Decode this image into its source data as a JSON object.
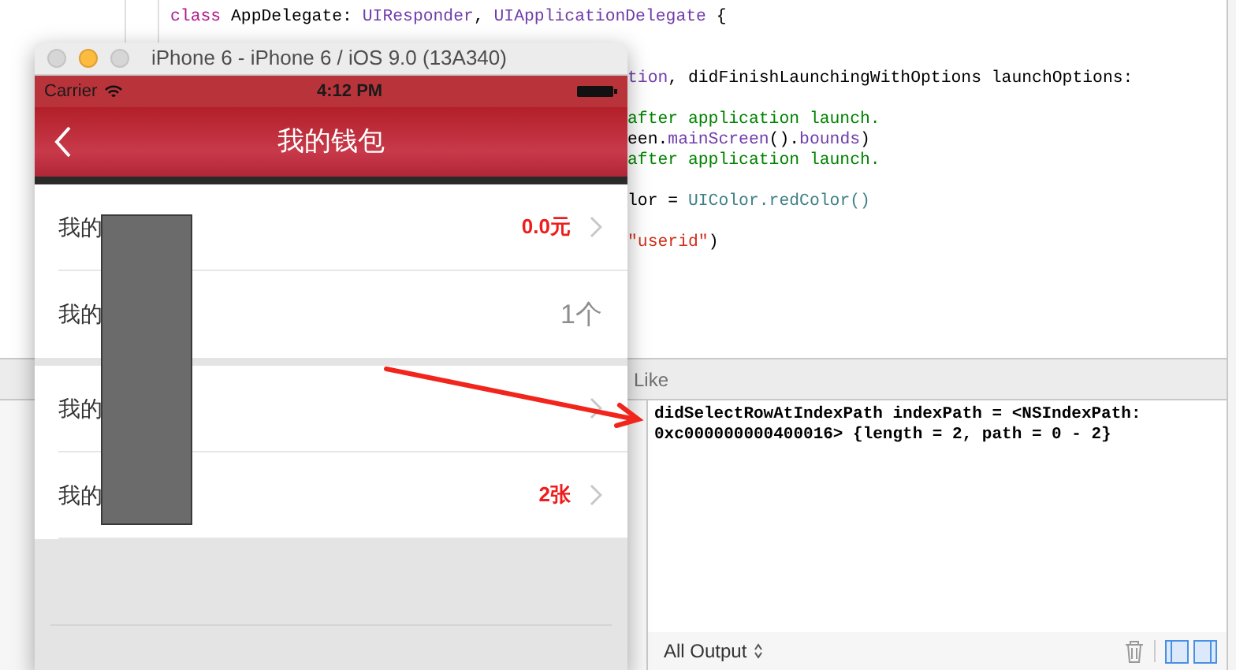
{
  "editor": {
    "code_lines": [
      {
        "kind": "full",
        "segments": [
          {
            "kind": "keyword",
            "text": "class"
          },
          {
            "kind": "plain",
            "text": " AppDelegate: "
          },
          {
            "kind": "type",
            "text": "UIResponder"
          },
          {
            "kind": "plain",
            "text": ", "
          },
          {
            "kind": "type",
            "text": "UIApplicationDelegate"
          },
          {
            "kind": "plain",
            "text": " {"
          }
        ]
      },
      {
        "kind": "blank"
      },
      {
        "kind": "blank"
      },
      {
        "kind": "clipped",
        "segments": [
          {
            "kind": "type",
            "text": "tion"
          },
          {
            "kind": "plain",
            "text": ", didFinishLaunchingWithOptions launchOptions:"
          }
        ]
      },
      {
        "kind": "blank"
      },
      {
        "kind": "clipped",
        "segments": [
          {
            "kind": "comment",
            "text": "after application launch."
          }
        ]
      },
      {
        "kind": "clipped",
        "segments": [
          {
            "kind": "plain",
            "text": "een."
          },
          {
            "kind": "type",
            "text": "mainScreen"
          },
          {
            "kind": "plain",
            "text": "()."
          },
          {
            "kind": "type",
            "text": "bounds"
          },
          {
            "kind": "plain",
            "text": ")"
          }
        ]
      },
      {
        "kind": "clipped",
        "segments": [
          {
            "kind": "comment",
            "text": "after application launch."
          }
        ]
      },
      {
        "kind": "blank"
      },
      {
        "kind": "clipped",
        "segments": [
          {
            "kind": "plain",
            "text": "lor = "
          },
          {
            "kind": "call",
            "text": "UIColor.redColor()"
          }
        ]
      },
      {
        "kind": "blank"
      },
      {
        "kind": "clipped",
        "segments": [
          {
            "kind": "string",
            "text": "\"userid\""
          },
          {
            "kind": "plain",
            "text": ")"
          }
        ]
      }
    ]
  },
  "debug": {
    "tab_label": "Like",
    "output": [
      "didSelectRowAtIndexPath indexPath = <NSIndexPath:",
      "0xc000000000400016> {length = 2, path = 0 - 2}"
    ],
    "filter": "All Output"
  },
  "simulator": {
    "title": "iPhone 6 - iPhone 6 / iOS 9.0 (13A340)",
    "carrier": "Carrier",
    "time": "4:12 PM",
    "nav_title": "我的钱包",
    "sections": [
      [
        {
          "label": "我的",
          "value": "0.0元",
          "kind": "accent",
          "chevron": true
        },
        {
          "label": "我的",
          "value": "1个",
          "kind": "muted",
          "chevron": false
        }
      ],
      [
        {
          "label": "我的",
          "chevron": true
        },
        {
          "label": "我的",
          "value": "2张",
          "kind": "accent",
          "chevron": true
        }
      ]
    ]
  }
}
